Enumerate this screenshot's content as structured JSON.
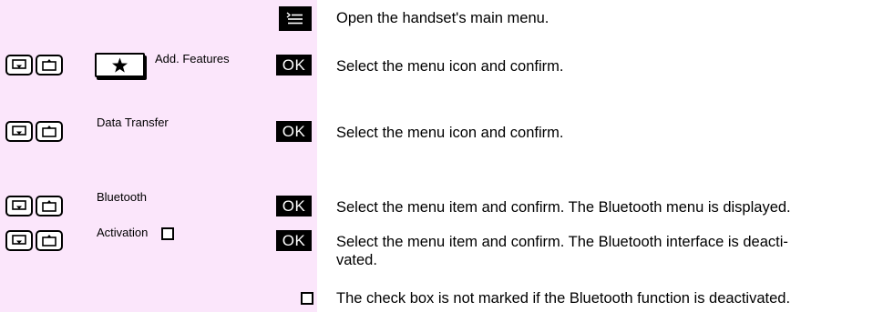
{
  "rows": [
    {
      "description": "Open the handset's main menu."
    },
    {
      "label": "Add. Features",
      "ok": "OK",
      "description": "Select the menu icon and confirm."
    },
    {
      "label": "Data Transfer",
      "ok": "OK",
      "description": "Select the menu icon and confirm."
    },
    {
      "label": "Bluetooth",
      "ok": "OK",
      "description": "Select the menu item and confirm. The Bluetooth menu is displayed."
    },
    {
      "label": "Activation",
      "ok": "OK",
      "description_line1": "Select the menu item and confirm. The Bluetooth interface is deacti-",
      "description_line2": "vated."
    },
    {
      "description": "The check box is not marked if the Bluetooth function is deactivated."
    }
  ],
  "icons": {
    "down": "arrow-down-icon",
    "up": "arrow-up-icon",
    "star": "star-icon",
    "menu": "menu-icon",
    "checkbox": "checkbox-icon"
  },
  "colors": {
    "band": "#fbe6fb",
    "ok_bg": "#000000",
    "ok_fg": "#ffffff"
  }
}
